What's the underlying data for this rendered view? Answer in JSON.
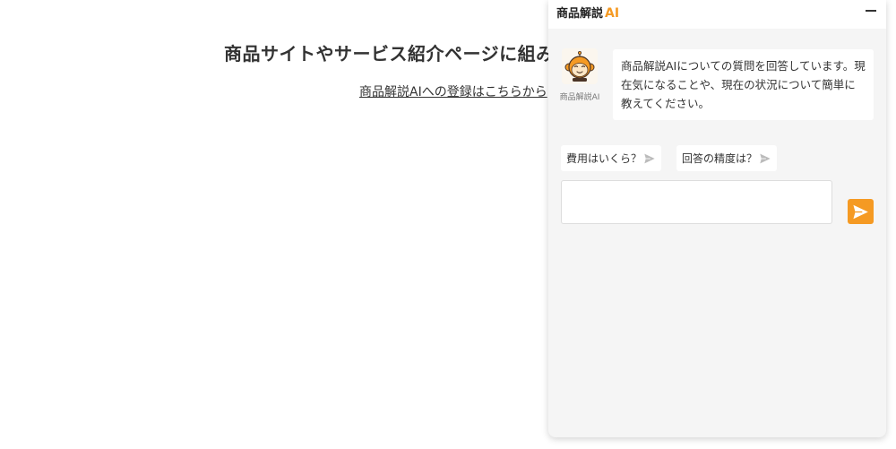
{
  "page": {
    "heading": "商品サイトやサービス紹介ページに組み込",
    "register_link": "商品解説AIへの登録はこちらから"
  },
  "chat": {
    "title_prefix": "商品解説",
    "title_ai": "AI",
    "bot_name": "商品解説AI",
    "bot_message": "商品解説AIについての質問を回答しています。現在気になることや、現在の状況について簡単に教えてください。",
    "suggestions": [
      {
        "label": "費用はいくら？"
      },
      {
        "label": "回答の精度は？"
      }
    ],
    "input_value": "",
    "input_placeholder": ""
  },
  "colors": {
    "accent": "#f59a23",
    "panel_bg": "#f5f5f5",
    "text": "#333333",
    "suggestion_send_icon": "#bbbbbb"
  },
  "icons": {
    "minimize": "minimize-icon",
    "avatar": "monkey-robot-icon",
    "suggestion_send": "paper-plane-icon",
    "send": "paper-plane-icon"
  }
}
